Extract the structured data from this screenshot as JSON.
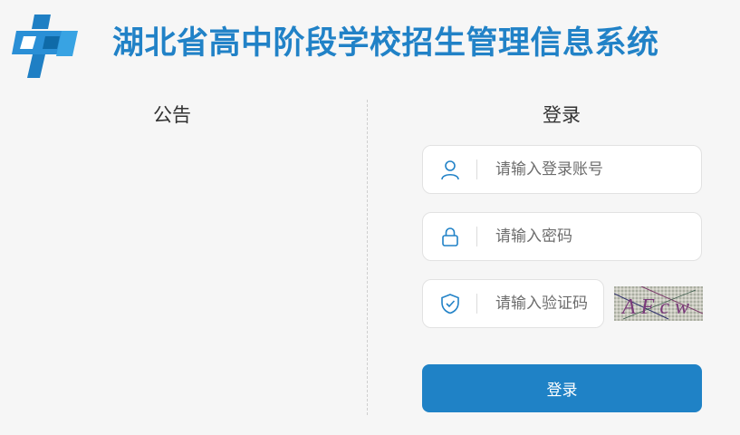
{
  "header": {
    "title": "湖北省高中阶段学校招生管理信息系统",
    "logo_icon": "system-logo-icon"
  },
  "notice": {
    "title": "公告"
  },
  "login": {
    "title": "登录",
    "username_placeholder": "请输入登录账号",
    "password_placeholder": "请输入密码",
    "captcha_placeholder": "请输入验证码",
    "captcha_text": "AFcw",
    "submit_label": "登录",
    "icons": [
      "user-icon",
      "lock-icon",
      "shield-check-icon"
    ]
  },
  "colors": {
    "brand": "#2182c7",
    "button": "#1f82c6",
    "background": "#f6f6f6"
  }
}
